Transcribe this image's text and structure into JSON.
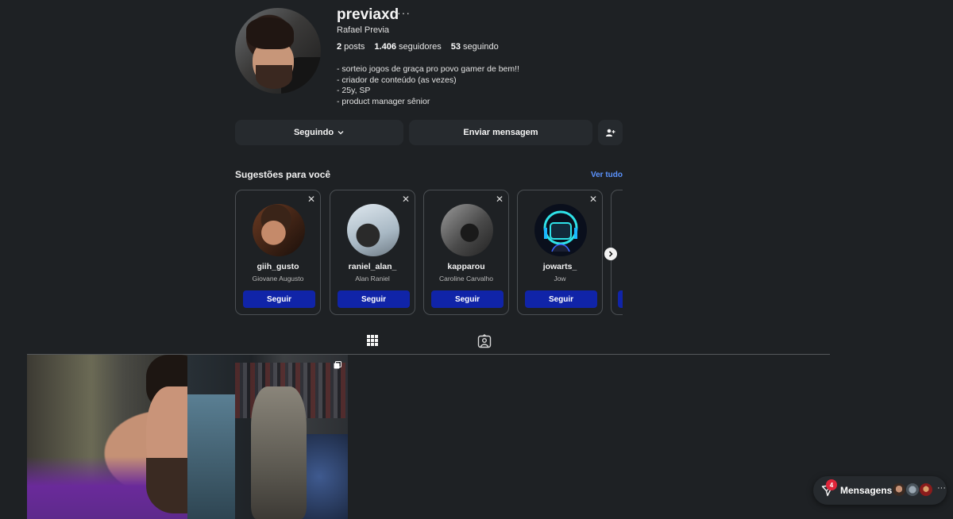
{
  "profile": {
    "username": "previaxd",
    "more_icon": "···",
    "full_name": "Rafael Previa",
    "stats": {
      "posts_count": "2",
      "posts_label": "posts",
      "followers_count": "1.406",
      "followers_label": "seguidores",
      "following_count": "53",
      "following_label": "seguindo"
    },
    "bio": [
      "- sorteio jogos de graça pro povo gamer de bem!!",
      "- criador de conteúdo (as vezes)",
      "- 25y, SP",
      "- product manager sênior"
    ]
  },
  "actions": {
    "following_label": "Seguindo",
    "message_label": "Enviar mensagem",
    "add_user_icon": "add-user-icon"
  },
  "suggestions": {
    "title": "Sugestões para você",
    "see_all": "Ver tudo",
    "follow_label": "Seguir",
    "items": [
      {
        "username": "giih_gusto",
        "name": "Giovane Augusto"
      },
      {
        "username": "raniel_alan_",
        "name": "Alan Raniel"
      },
      {
        "username": "kapparou",
        "name": "Caroline Carvalho"
      },
      {
        "username": "jowarts_",
        "name": "Jow"
      }
    ]
  },
  "tabs": [
    {
      "name": "posts",
      "icon": "grid-icon",
      "active": true
    },
    {
      "name": "tagged",
      "icon": "tagged-icon",
      "active": false
    }
  ],
  "messages": {
    "label": "Mensagens",
    "unread_count": "4",
    "more": "···"
  },
  "colors": {
    "background": "#1e2124",
    "button_dark": "#262a2e",
    "follow_button": "#1024a8",
    "link": "#5b93ff",
    "badge": "#e0253a"
  }
}
